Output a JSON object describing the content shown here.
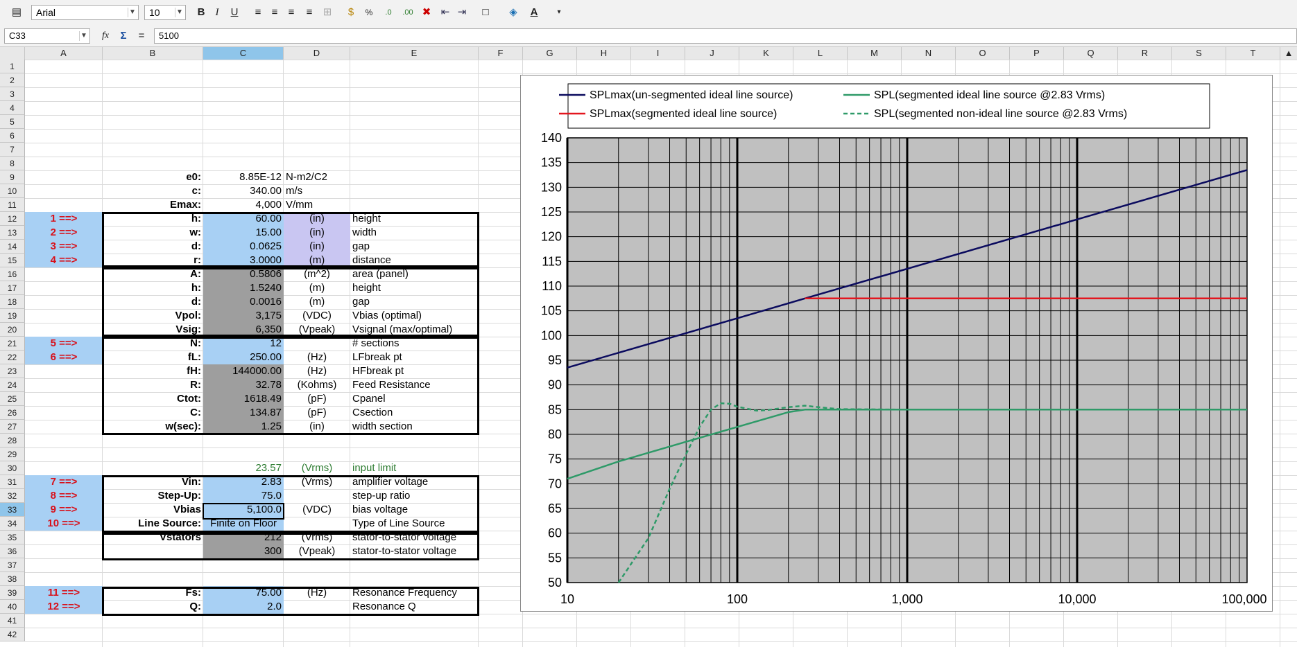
{
  "toolbar": {
    "font_name": "Arial",
    "font_size": "10",
    "bold_label": "B",
    "italic_label": "I",
    "underline_label": "U"
  },
  "formula": {
    "cell_ref": "C33",
    "fx": "fx",
    "sigma": "Σ",
    "equals": "=",
    "value": "5100"
  },
  "columns": [
    "A",
    "B",
    "C",
    "D",
    "E",
    "F",
    "G",
    "H",
    "I",
    "J",
    "K",
    "L",
    "M",
    "N",
    "O",
    "P",
    "Q",
    "R",
    "S",
    "T"
  ],
  "rows": [
    "1",
    "2",
    "3",
    "4",
    "5",
    "6",
    "7",
    "8",
    "9",
    "10",
    "11",
    "12",
    "13",
    "14",
    "15",
    "16",
    "17",
    "18",
    "19",
    "20",
    "21",
    "22",
    "23",
    "24",
    "25",
    "26",
    "27",
    "28",
    "29",
    "30",
    "31",
    "32",
    "33",
    "34",
    "35",
    "36",
    "37",
    "38",
    "39",
    "40",
    "41",
    "42"
  ],
  "sheet": {
    "r9": {
      "b": "e0:",
      "c": "8.85E-12",
      "d": "N-m2/C2"
    },
    "r10": {
      "b": "c:",
      "c": "340.00",
      "d": "m/s"
    },
    "r11": {
      "b": "Emax:",
      "c": "4,000",
      "d": "V/mm"
    },
    "r12": {
      "a": "1 ==>",
      "b": "h:",
      "c": "60.00",
      "d": "(in)",
      "e": "height"
    },
    "r13": {
      "a": "2 ==>",
      "b": "w:",
      "c": "15.00",
      "d": "(in)",
      "e": "width"
    },
    "r14": {
      "a": "3 ==>",
      "b": "d:",
      "c": "0.0625",
      "d": "(in)",
      "e": "gap"
    },
    "r15": {
      "a": "4 ==>",
      "b": "r:",
      "c": "3.0000",
      "d": "(m)",
      "e": "distance"
    },
    "r16": {
      "b": "A:",
      "c": "0.5806",
      "d": "(m^2)",
      "e": "area (panel)"
    },
    "r17": {
      "b": "h:",
      "c": "1.5240",
      "d": "(m)",
      "e": "height"
    },
    "r18": {
      "b": "d:",
      "c": "0.0016",
      "d": "(m)",
      "e": "gap"
    },
    "r19": {
      "b": "Vpol:",
      "c": "3,175",
      "d": "(VDC)",
      "e": "Vbias (optimal)"
    },
    "r20": {
      "b": "Vsig:",
      "c": "6,350",
      "d": "(Vpeak)",
      "e": "Vsignal (max/optimal)"
    },
    "r21": {
      "a": "5 ==>",
      "b": "N:",
      "c": "12",
      "d": "",
      "e": "# sections"
    },
    "r22": {
      "a": "6 ==>",
      "b": "fL:",
      "c": "250.00",
      "d": "(Hz)",
      "e": "LFbreak pt"
    },
    "r23": {
      "b": "fH:",
      "c": "144000.00",
      "d": "(Hz)",
      "e": "HFbreak pt"
    },
    "r24": {
      "b": "R:",
      "c": "32.78",
      "d": "(Kohms)",
      "e": "Feed Resistance"
    },
    "r25": {
      "b": "Ctot:",
      "c": "1618.49",
      "d": "(pF)",
      "e": "Cpanel"
    },
    "r26": {
      "b": "C:",
      "c": "134.87",
      "d": "(pF)",
      "e": "Csection"
    },
    "r27": {
      "b": "w(sec):",
      "c": "1.25",
      "d": "(in)",
      "e": "width section"
    },
    "r30": {
      "c": "23.57",
      "d": "(Vrms)",
      "e": "input limit"
    },
    "r31": {
      "a": "7 ==>",
      "b": "Vin:",
      "c": "2.83",
      "d": "(Vrms)",
      "e": "amplifier voltage"
    },
    "r32": {
      "a": "8 ==>",
      "b": "Step-Up:",
      "c": "75.0",
      "d": "",
      "e": "step-up ratio"
    },
    "r33": {
      "a": "9 ==>",
      "b": "Vbias",
      "c": "5,100.0",
      "d": "(VDC)",
      "e": "bias voltage"
    },
    "r34": {
      "a": "10 ==>",
      "b": "Line Source:",
      "c": "Finite on Floor",
      "d": "",
      "e": "Type of Line Source"
    },
    "r35": {
      "b": "Vstators",
      "c": "212",
      "d": "(Vrms)",
      "e": "stator-to-stator voltage"
    },
    "r36": {
      "c": "300",
      "d": "(Vpeak)",
      "e": "stator-to-stator voltage"
    },
    "r39": {
      "a": "11 ==>",
      "b": "Fs:",
      "c": "75.00",
      "d": "(Hz)",
      "e": "Resonance Frequency"
    },
    "r40": {
      "a": "12 ==>",
      "b": "Q:",
      "c": "2.0",
      "d": "",
      "e": "Resonance Q"
    }
  },
  "colors": {
    "input_blue": "#a8d0f4",
    "unit_lavender": "#c9c6f2",
    "calc_gray": "#9e9e9e",
    "label_red": "#d8101a",
    "note_green": "#2e7d32",
    "plot_bg": "#c0c0c0"
  },
  "chart_data": {
    "type": "line",
    "x_scale": "log",
    "xlim": [
      10,
      100000
    ],
    "ylim": [
      50,
      140
    ],
    "x_ticks": [
      "10",
      "100",
      "1,000",
      "10,000",
      "100,000"
    ],
    "y_ticks": [
      "50",
      "55",
      "60",
      "65",
      "70",
      "75",
      "80",
      "85",
      "90",
      "95",
      "100",
      "105",
      "110",
      "115",
      "120",
      "125",
      "130",
      "135",
      "140"
    ],
    "grid": true,
    "legend_position": "top",
    "series": [
      {
        "name": "SPLmax(un-segmented ideal line source)",
        "color": "#0b0b5e",
        "dash": false,
        "x": [
          10,
          100,
          250,
          1000,
          10000,
          100000
        ],
        "y": [
          93.5,
          103.5,
          107.5,
          113.5,
          123.5,
          133.5
        ]
      },
      {
        "name": "SPLmax(segmented ideal line source)",
        "color": "#e3161e",
        "dash": false,
        "x": [
          250,
          1000,
          10000,
          100000
        ],
        "y": [
          107.5,
          107.5,
          107.5,
          107.5
        ]
      },
      {
        "name": "SPL(segmented ideal line source @2.83 Vrms)",
        "color": "#2e9a68",
        "dash": false,
        "x": [
          10,
          20,
          50,
          100,
          200,
          250,
          300,
          1000,
          10000,
          100000
        ],
        "y": [
          71,
          74.5,
          78.5,
          81.5,
          84.5,
          85,
          85,
          85,
          85,
          85
        ]
      },
      {
        "name": "SPL(segmented non-ideal line source @2.83 Vrms)",
        "color": "#2e9a68",
        "dash": true,
        "x": [
          20,
          30,
          40,
          50,
          60,
          70,
          80,
          90,
          100,
          130,
          150,
          200,
          250,
          300,
          400,
          1000,
          100000
        ],
        "y": [
          50,
          59,
          69,
          76,
          81.5,
          85,
          86.3,
          86.2,
          85.6,
          84.8,
          84.9,
          85.5,
          85.8,
          85.5,
          85.1,
          85,
          85
        ]
      }
    ]
  }
}
